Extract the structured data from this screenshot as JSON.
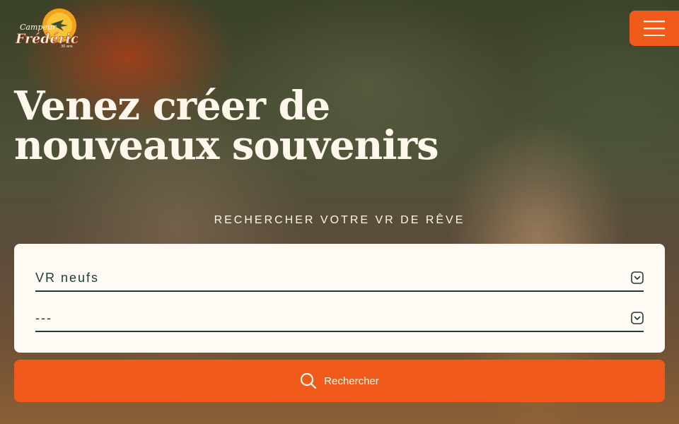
{
  "brand": {
    "logo_top": "Campeur",
    "logo_main": "Frédéric",
    "logo_badge": "30 ans"
  },
  "header": {
    "menu_icon": "hamburger-menu-icon"
  },
  "hero": {
    "headline": "Venez créer de nouveaux souvenirs"
  },
  "search": {
    "title": "Rechercher votre VR de rêve",
    "fields": [
      {
        "value": "VR neufs",
        "icon": "chevron-down-icon"
      },
      {
        "value": "---",
        "icon": "chevron-down-icon"
      }
    ],
    "button_label": "Rechercher",
    "button_icon": "search-icon"
  },
  "colors": {
    "accent": "#f05a1a",
    "card_background": "#fffaf3",
    "field_text": "#1f3b36",
    "hero_text": "#fff7ec"
  }
}
